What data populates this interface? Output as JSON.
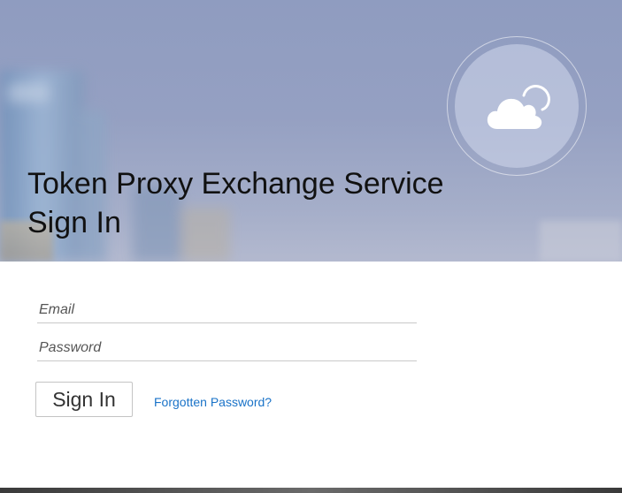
{
  "header": {
    "title_line1": "Token Proxy Exchange Service",
    "title_line2": "Sign In",
    "badge_icon": "cloud-icon"
  },
  "form": {
    "email_placeholder": "Email",
    "email_value": "",
    "password_placeholder": "Password",
    "password_value": "",
    "signin_label": "Sign In",
    "forgot_label": "Forgotten Password?"
  },
  "colors": {
    "hero_tint": "#95a0c2",
    "link": "#1a73c8",
    "title_text": "#111111"
  }
}
